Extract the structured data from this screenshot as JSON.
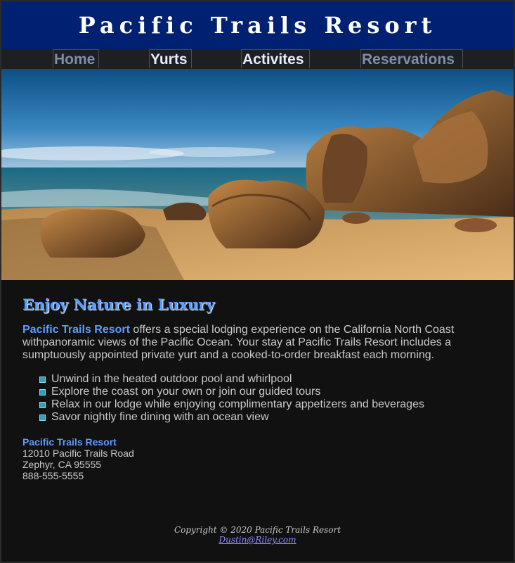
{
  "header": {
    "title": "Pacific Trails Resort"
  },
  "nav": {
    "items": [
      {
        "label": "Home"
      },
      {
        "label": "Yurts"
      },
      {
        "label": "Activites"
      },
      {
        "label": "Reservations"
      }
    ]
  },
  "hero": {
    "image": "beach-coastline-with-rocks"
  },
  "main": {
    "heading": "Enjoy Nature in Luxury",
    "intro_brand": "Pacific Trails Resort",
    "intro_text": " offers a special lodging experience on the California North Coast withpanoramic views of the Pacific Ocean. Your stay at Pacific Trails Resort includes a sumptuously appointed private yurt and a cooked-to-order breakfast each morning.",
    "features": [
      "Unwind in the heated outdoor pool and whirlpool",
      "Explore the coast on your own or join our guided tours",
      "Relax in our lodge while enjoying complimentary appetizers and beverages",
      "Savor nightly fine dining with an ocean view"
    ]
  },
  "contact": {
    "name": "Pacific Trails Resort",
    "street": "12010 Pacific Trails Road",
    "city": "Zephyr, CA 95555",
    "phone": "888-555-5555"
  },
  "footer": {
    "copyright": "Copyright © 2020 Pacific Trails Resort",
    "email": "Dustin@Riley.com"
  },
  "colors": {
    "header_bg": "#002171",
    "accent": "#5c9cff",
    "page_bg": "#111111"
  }
}
